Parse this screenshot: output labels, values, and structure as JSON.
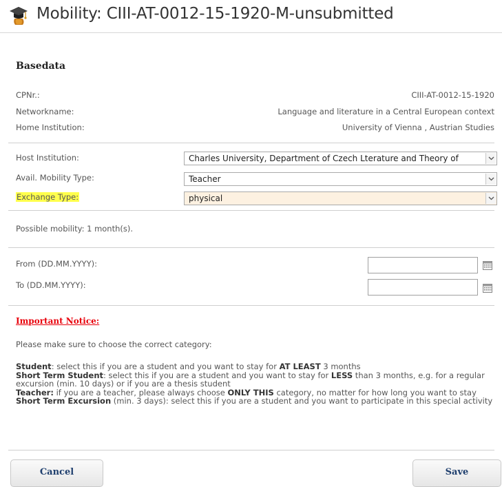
{
  "header": {
    "title": "Mobility: CIII-AT-0012-15-1920-M-unsubmitted",
    "icon": "graduation-cap-icon"
  },
  "basedata": {
    "title": "Basedata",
    "rows": [
      {
        "label": "CPNr.:",
        "value": "CIII-AT-0012-15-1920"
      },
      {
        "label": "Networkname:",
        "value": "Language and literature in a Central European context"
      },
      {
        "label": "Home Institution:",
        "value": "University of Vienna , Austrian Studies"
      }
    ]
  },
  "form": {
    "host_institution": {
      "label": "Host Institution:",
      "value": "Charles University, Department of Czech Lterature and Theory of"
    },
    "mobility_type": {
      "label": "Avail. Mobility Type:",
      "value": "Teacher"
    },
    "exchange_type": {
      "label": "Exchange Type:",
      "value": "physical"
    }
  },
  "possible_mobility": "Possible mobility: 1 month(s).",
  "dates": {
    "from_label": "From (DD.MM.YYYY):",
    "to_label": "To (DD.MM.YYYY):",
    "from_value": "",
    "to_value": "",
    "icon": "calendar-icon"
  },
  "notice": {
    "title": "Important Notice:",
    "intro": "Please make sure to choose the correct category:",
    "student_term": "Student",
    "student_text": ": select this if you are a student and you want to stay for ",
    "student_em": "AT LEAST",
    "student_tail": " 3 months",
    "short_student_term": "Short Term Student",
    "short_student_text": ": select this if you are a student and you want to stay for ",
    "short_student_em": "LESS",
    "short_student_tail": " than 3 months, e.g. for a regular excursion (min. 10 days) or if you are a thesis student",
    "teacher_term": "Teacher:",
    "teacher_text": " if you are a teacher, please always choose ",
    "teacher_em": "ONLY THIS",
    "teacher_tail": " category, no matter for how long you want to stay",
    "excursion_term": "Short Term Excursion",
    "excursion_text": " (min. 3 days): select this if you are a student and you want to participate in this special activity"
  },
  "buttons": {
    "cancel": "Cancel",
    "save": "Save"
  },
  "colors": {
    "notice_red": "#e8000b",
    "highlight_yellow": "#ffff4d",
    "select_highlight": "#fdf1e1",
    "button_text": "#1f3f6e"
  }
}
